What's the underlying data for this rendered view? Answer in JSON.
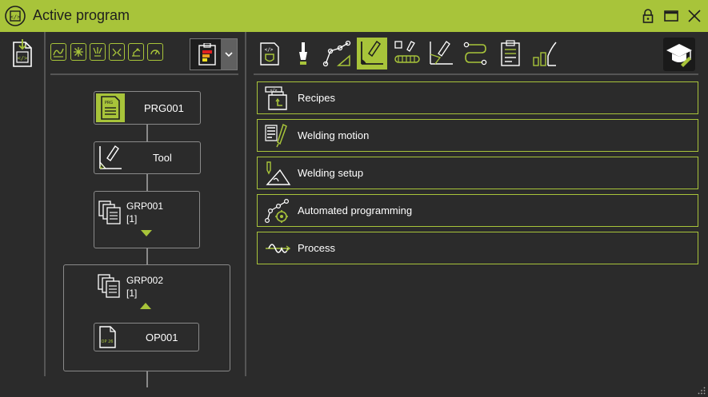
{
  "window": {
    "title": "Active program"
  },
  "colors": {
    "accent": "#a8c43a",
    "background": "#2b2b2b",
    "border": "#8a8a8a"
  },
  "tree": {
    "program": {
      "label": "PRG001",
      "icon_text": "PRG"
    },
    "tool": {
      "label": "Tool"
    },
    "group1": {
      "label": "GRP001",
      "count": "[1]"
    },
    "group2": {
      "label": "GRP002",
      "count": "[1]"
    },
    "operation": {
      "label": "OP001",
      "icon_text": "OP 26"
    }
  },
  "menu": {
    "items": [
      {
        "label": "Recipes",
        "icon": "recipes-icon"
      },
      {
        "label": "Welding motion",
        "icon": "welding-motion-icon"
      },
      {
        "label": "Welding setup",
        "icon": "welding-setup-icon"
      },
      {
        "label": "Automated programming",
        "icon": "automated-programming-icon"
      },
      {
        "label": "Process",
        "icon": "process-icon"
      }
    ]
  }
}
